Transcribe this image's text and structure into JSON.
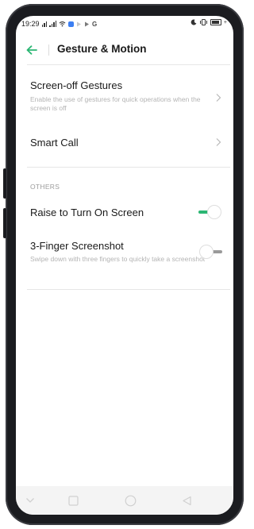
{
  "status_bar": {
    "time": "19:29",
    "icons": [
      "signal-icon",
      "signal-icon",
      "wifi-icon",
      "app-notification-icon",
      "play-icon",
      "google-icon",
      "moon-icon",
      "vibrate-icon",
      "battery-icon"
    ]
  },
  "header": {
    "title": "Gesture & Motion",
    "back_icon": "arrow-left-icon",
    "accent_color": "#2bb673"
  },
  "settings": {
    "screen_off": {
      "title": "Screen-off Gestures",
      "subtitle": "Enable the use of gestures for quick operations when the screen is off"
    },
    "smart_call": {
      "title": "Smart Call"
    },
    "others_label": "OTHERS",
    "raise_to_turn_on": {
      "title": "Raise to Turn On Screen",
      "enabled": true
    },
    "three_finger": {
      "title": "3-Finger Screenshot",
      "subtitle": "Swipe down with three fingers to quickly take a screenshot",
      "enabled": false
    }
  },
  "nav_bar": {
    "icons": [
      "chevron-down-icon",
      "square-icon",
      "circle-icon",
      "triangle-back-icon"
    ]
  }
}
